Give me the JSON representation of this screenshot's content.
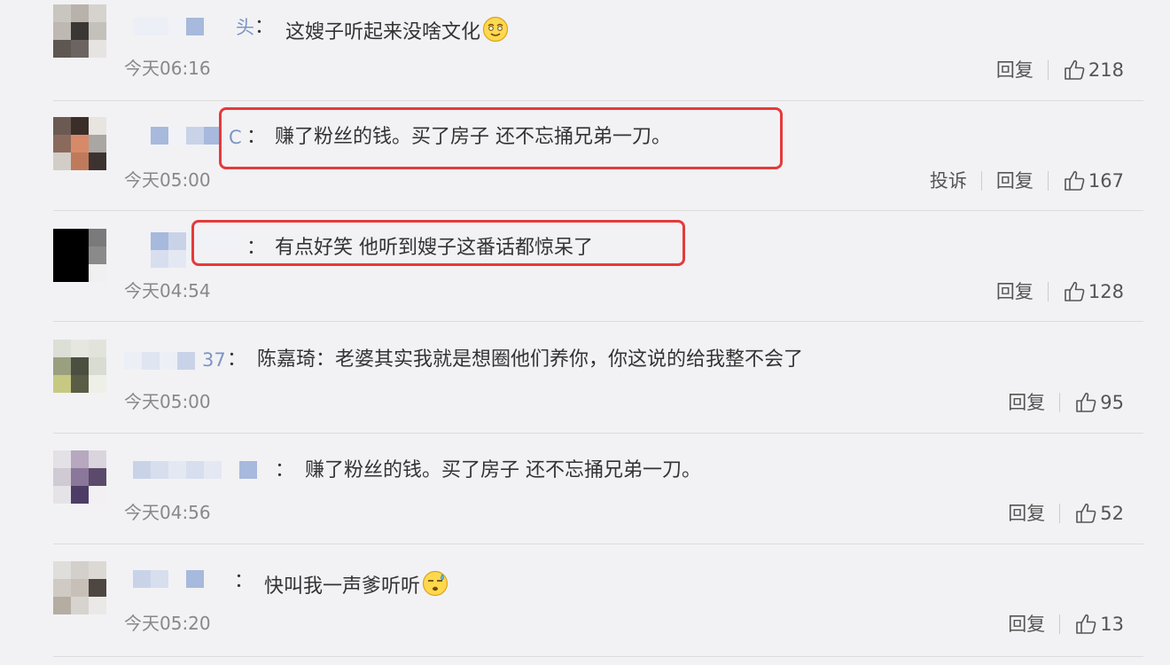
{
  "comments": [
    {
      "name_tail": "头",
      "colon": "：",
      "text": "这嫂子听起来没啥文化",
      "emoji": "smirk-emoji",
      "time": "今天06:16",
      "actions": {
        "reply": "回复"
      },
      "likes": "218",
      "highlighted": false
    },
    {
      "name_tail": "C",
      "colon": "：",
      "text": "赚了粉丝的钱。买了房子 还不忘捅兄弟一刀。",
      "time": "今天05:00",
      "actions": {
        "report": "投诉",
        "reply": "回复"
      },
      "likes": "167",
      "highlighted": true
    },
    {
      "name_tail": "",
      "colon": "：",
      "text": "有点好笑 他听到嫂子这番话都惊呆了",
      "time": "今天04:54",
      "actions": {
        "reply": "回复"
      },
      "likes": "128",
      "highlighted": true
    },
    {
      "name_tail": "37",
      "colon": "：",
      "text": "陈嘉琦：老婆其实我就是想圈他们养你，你这说的给我整不会了",
      "time": "今天05:00",
      "actions": {
        "reply": "回复"
      },
      "likes": "95",
      "highlighted": false
    },
    {
      "name_tail": "",
      "colon": "：",
      "text": "赚了粉丝的钱。买了房子 还不忘捅兄弟一刀。",
      "time": "今天04:56",
      "actions": {
        "reply": "回复"
      },
      "likes": "52",
      "highlighted": false
    },
    {
      "name_tail": "",
      "colon": "：",
      "text": "快叫我一声爹听听",
      "emoji": "sweat-emoji",
      "time": "今天05:20",
      "actions": {
        "reply": "回复"
      },
      "likes": "13",
      "highlighted": false
    }
  ],
  "colors": {
    "highlight": "#e53a3a",
    "name_link": "#7c95c4",
    "time": "#888888"
  }
}
